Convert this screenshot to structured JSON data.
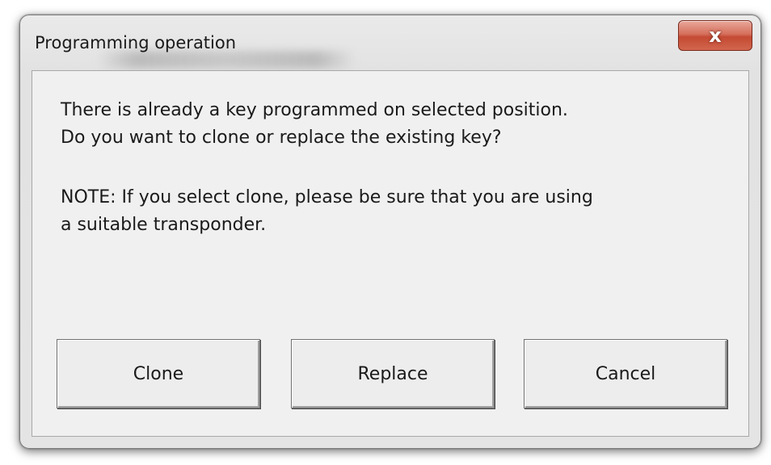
{
  "dialog": {
    "title": "Programming operation",
    "close_label": "x"
  },
  "message": {
    "line1": "There is already a key programmed on selected position.",
    "line2": "Do you want to clone or replace the existing key?",
    "note_line1": "NOTE: If you select clone, please be sure that you are using",
    "note_line2": "a suitable transponder."
  },
  "buttons": {
    "clone": "Clone",
    "replace": "Replace",
    "cancel": "Cancel"
  }
}
